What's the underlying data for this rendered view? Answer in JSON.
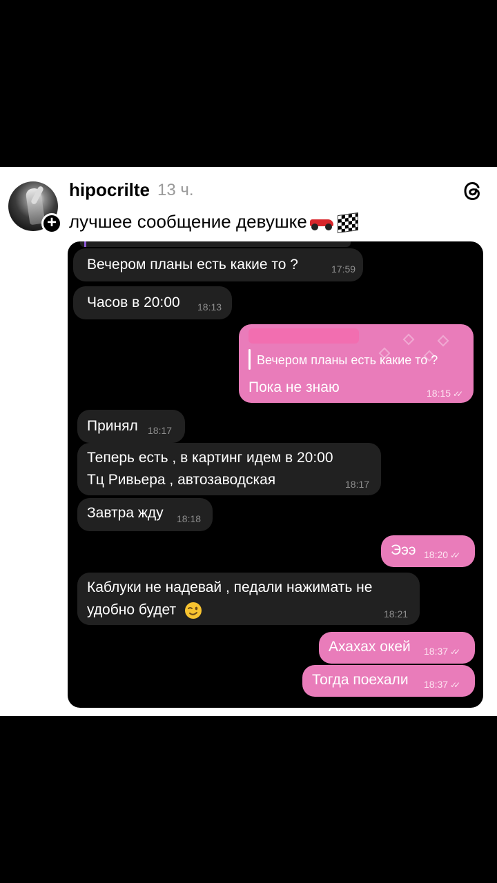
{
  "post": {
    "username": "hipocrilte",
    "time_ago": "13 ч.",
    "caption": "лучшее сообщение девушке"
  },
  "icons": {
    "avatar": "avatar-photo",
    "follow": "plus-icon",
    "app": "threads-logo-icon",
    "caption_emoji_1": "racing-car-emoji",
    "caption_emoji_2": "checkered-flag-emoji",
    "chat_emoji": "winking-face-emoji",
    "read_status": "double-check-icon"
  },
  "colors": {
    "incoming_bubble": "#212121",
    "outgoing_bubble": "#e97cba",
    "chat_background": "#000000"
  },
  "chat": {
    "messages": [
      {
        "side": "in",
        "text": "Вечером планы есть какие то ?",
        "time": "17:59"
      },
      {
        "side": "in",
        "text": "Часов в 20:00",
        "time": "18:13"
      },
      {
        "side": "out",
        "reply_to": "Вечером планы есть какие то ?",
        "text": "Пока не знаю",
        "time": "18:15"
      },
      {
        "side": "in",
        "text": "Принял",
        "time": "18:17"
      },
      {
        "side": "in",
        "line1": "Теперь есть , в картинг идем в 20:00",
        "line2": "Тц Ривьера , автозаводская",
        "time": "18:17"
      },
      {
        "side": "in",
        "text": "Завтра жду",
        "time": "18:18"
      },
      {
        "side": "out",
        "text": "Эээ",
        "time": "18:20"
      },
      {
        "side": "in",
        "line1": "Каблуки не надевай , педали нажимать не",
        "line2": "удобно будет",
        "time": "18:21"
      },
      {
        "side": "out",
        "text": "Ахахах окей",
        "time": "18:37"
      },
      {
        "side": "out",
        "text": "Тогда поехали",
        "time": "18:37"
      }
    ]
  }
}
